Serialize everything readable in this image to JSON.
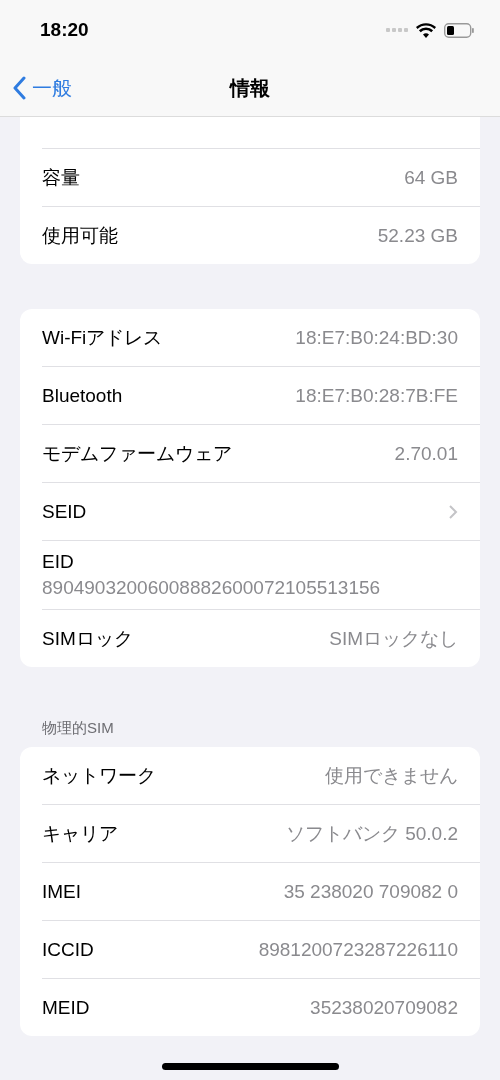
{
  "status_bar": {
    "time": "18:20"
  },
  "nav": {
    "back": "一般",
    "title": "情報"
  },
  "sections": [
    {
      "rows": [
        {
          "kind": "value",
          "label": "容量",
          "value": "64 GB"
        },
        {
          "kind": "value",
          "label": "使用可能",
          "value": "52.23 GB"
        }
      ]
    },
    {
      "rows": [
        {
          "kind": "value",
          "label": "Wi-Fiアドレス",
          "value": "18:E7:B0:24:BD:30"
        },
        {
          "kind": "value",
          "label": "Bluetooth",
          "value": "18:E7:B0:28:7B:FE"
        },
        {
          "kind": "value",
          "label": "モデムファームウェア",
          "value": "2.70.01"
        },
        {
          "kind": "link",
          "label": "SEID"
        },
        {
          "kind": "stacked",
          "label": "EID",
          "value": "89049032006008882600072105513156"
        },
        {
          "kind": "value",
          "label": "SIMロック",
          "value": "SIMロックなし"
        }
      ]
    },
    {
      "header": "物理的SIM",
      "rows": [
        {
          "kind": "value",
          "label": "ネットワーク",
          "value": "使用できません"
        },
        {
          "kind": "value",
          "label": "キャリア",
          "value": "ソフトバンク 50.0.2"
        },
        {
          "kind": "value",
          "label": "IMEI",
          "value": "35 238020 709082 0"
        },
        {
          "kind": "value",
          "label": "ICCID",
          "value": "8981200723287226110"
        },
        {
          "kind": "value",
          "label": "MEID",
          "value": "35238020709082"
        }
      ]
    }
  ]
}
